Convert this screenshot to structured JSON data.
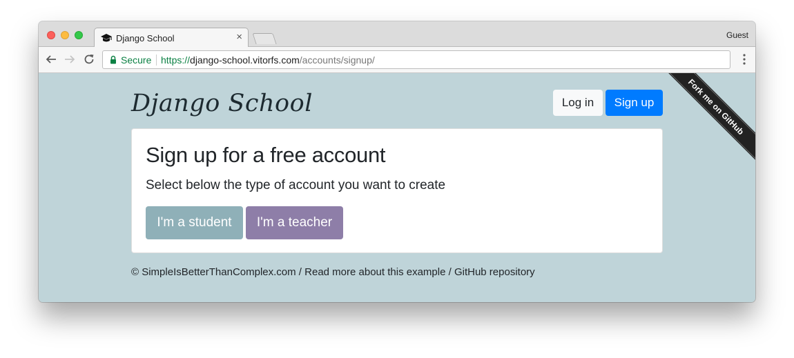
{
  "browser": {
    "tab_title": "Django School",
    "tab_close": "×",
    "profile": "Guest",
    "security_label": "Secure",
    "url_scheme": "https://",
    "url_host": "django-school.vitorfs.com",
    "url_path": "/accounts/signup/"
  },
  "navbar": {
    "brand": "Django School",
    "login_label": "Log in",
    "signup_label": "Sign up"
  },
  "ribbon": {
    "label": "Fork me on GitHub"
  },
  "card": {
    "title": "Sign up for a free account",
    "lead": "Select below the type of account you want to create",
    "student_button": "I'm a student",
    "teacher_button": "I'm a teacher"
  },
  "footer": {
    "copyright": "© SimpleIsBetterThanComplex.com",
    "sep1": " / ",
    "read_more": "Read more about this example",
    "sep2": " / ",
    "github": "GitHub repository"
  },
  "colors": {
    "page_background": "#bfd4d9",
    "primary": "#007bff",
    "student": "#8fb0b8",
    "teacher": "#8e7ea8",
    "secure_green": "#0b8043"
  }
}
